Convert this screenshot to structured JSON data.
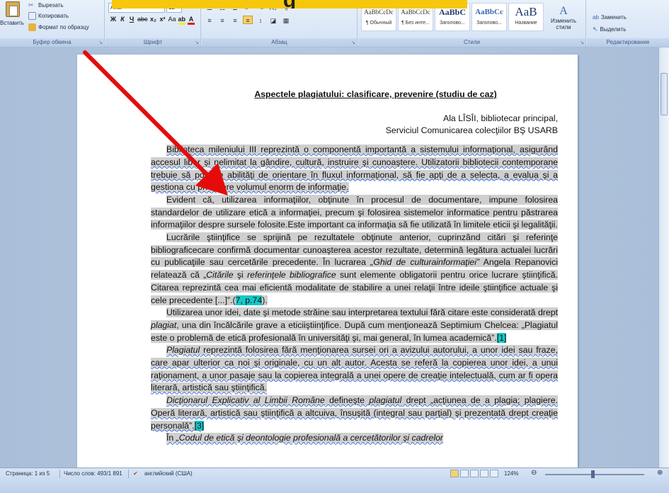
{
  "banner": {
    "title": "g"
  },
  "clipboard": {
    "paste": "Вставить",
    "cut": "Вырезать",
    "copy": "Копировать",
    "format_painter": "Формат по образцу",
    "group_label": "Буфер обмена"
  },
  "font": {
    "name": "Arial",
    "size": "12",
    "group_label": "Шрифт"
  },
  "paragraph": {
    "group_label": "Абзац"
  },
  "styles": {
    "tiles": [
      {
        "preview": "AaBbCcDc",
        "name": "¶ Обычный"
      },
      {
        "preview": "AaBbCcDc",
        "name": "¶ Без инте..."
      },
      {
        "preview": "AaBbC",
        "name": "Заголово..."
      },
      {
        "preview": "AaBbCc",
        "name": "Заголово..."
      },
      {
        "preview": "AaB",
        "name": "Название"
      }
    ],
    "change_styles": "Изменить стили",
    "group_label": "Стили"
  },
  "editing": {
    "replace": "Заменить",
    "select": "Выделить",
    "group_label": "Редактирование"
  },
  "document": {
    "title": "Aspectele plagiatului: clasificare, prevenire (studiu de caz)",
    "author_line1": "Ala LÎSÎI, bibliotecar principal,",
    "author_line2": "Serviciul Comunicarea colecţiilor BŞ USARB",
    "p1": "Biblioteca mileniului III reprezintă o componentă importantă a sistemului informaţional, asigurând accesul liber şi nelimitat la gândire, cultură, instruire şi cunoaştere. Utilizatorii bibliotecii contemporane trebuie să posede abilităţi de orientare în fluxul informaţional, să fie apţi de a selecta, a evalua şi a gestiona cu pricepere volumul enorm de informaţie.",
    "p2": "Evident că, utilizarea informaţiilor, obţinute în procesul de documentare, impune folosirea standardelor de utilizare etică a informaţiei, precum şi folosirea sistemelor informatice pentru păstrarea informaţiilor despre sursele folosite.Este important ca informaţia să fie utilizată în limitele eticii şi legalităţii.",
    "p3_a": "Lucrările ştiinţifice se sprijină pe rezultatele obţinute anterior, cuprinzând citări şi referinţe bibliograficecare confirmă documentar cunoaşterea acestor rezultate, determină legătura actualei lucrări cu publicaţiile sau cercetările precedente. În lucrarea ",
    "p3_italic": "„Ghid de culturainformaţiei”",
    "p3_b": " Angela Repanovici relatează că „",
    "p3_italic2": "Citările",
    "p3_c": " şi ",
    "p3_italic3": "referinţele bibliografice",
    "p3_d": " sunt elemente obligatorii pentru orice lucrare ştiinţifică. Citarea reprezintă cea mai eficientă modalitate de stabilire a unei relaţii între ideile ştiinţifice actuale şi cele precedente [...]”.(",
    "p3_ref": "7, p.74",
    "p3_e": ").",
    "p4_a": "Utilizarea unor idei, date şi metode străine sau interpretarea textului fără citare este considerată drept ",
    "p4_italic": "plagiat",
    "p4_b": ", una din încălcările grave a eticiiştiinţifice. După cum menţionează Septimium Chelcea: „Plagiatul este o problemă de etică profesională în universităţi şi, mai general, în lumea academică”.",
    "p4_ref": "[1]",
    "p5_italic": "Plagiatul",
    "p5_a": " reprezintă folosirea fără menţionarea sursei ori a avizului autorului, a unor idei sau fraze, care apar ulterior ca noi şi originale, cu un alt autor. Acesta se referă la copierea unor idei, a unui raţionament, a unor pasaje sau la copierea integrală a unei opere de creaţie intelectuală, cum ar fi opera literară, artistică sau ştiinţifică.",
    "p6_italic": "Dicţionarul Explicativ al Limbii Române",
    "p6_a": " defineşte ",
    "p6_italic2": "plagiatul",
    "p6_b": " drept „acţiunea de a plagia; plagiere. Operă literară, artistică sau ştiinţifică a altcuiva, însuşită (integral sau parţial) şi prezentată drept creaţie personală”.",
    "p6_ref": "[3]",
    "p7_a": "În ",
    "p7_italic": "„Codul de etică şi deontologie profesională a cercetătorilor şi cadrelor"
  },
  "status": {
    "page": "Страница: 1 из 5",
    "words": "Число слов: 493/1 891",
    "language": "английский (США)",
    "zoom": "124%"
  }
}
